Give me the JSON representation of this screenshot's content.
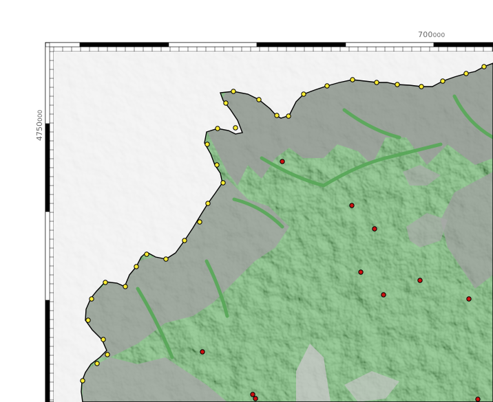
{
  "map": {
    "grid_labels": {
      "easting_major": "7",
      "easting_rest": "00",
      "easting_small": "000",
      "northing_major": "47",
      "northing_rest": "50",
      "northing_small": "000"
    },
    "colors": {
      "land_lowland": "#66b266",
      "highland_relief": "#9a9a9a",
      "sea_relief": "#f3f3f3",
      "coast_stroke": "#000000",
      "coastal_marker": "#ffee33",
      "inland_marker": "#cc1111",
      "frame": "#000000"
    },
    "markers": {
      "coastal_icon": "yellow-circle-icon",
      "inland_icon": "red-circle-icon"
    }
  }
}
